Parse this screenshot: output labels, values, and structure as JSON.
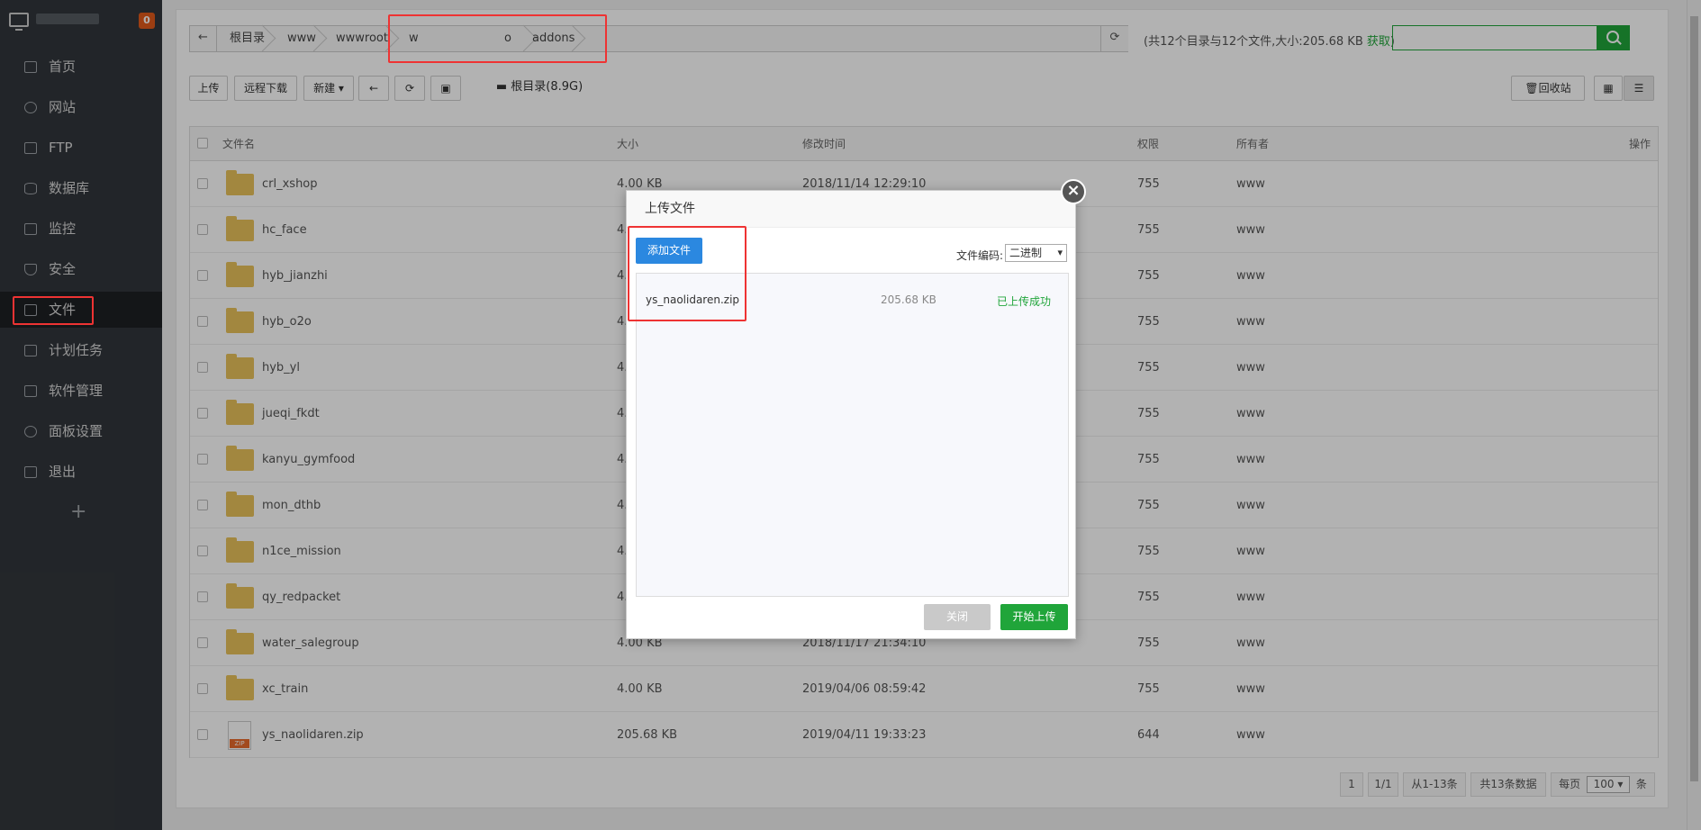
{
  "sidebar": {
    "badge": "0",
    "items": [
      {
        "label": "首页",
        "icon": "home-icon"
      },
      {
        "label": "网站",
        "icon": "globe-icon"
      },
      {
        "label": "FTP",
        "icon": "ftp-icon"
      },
      {
        "label": "数据库",
        "icon": "database-icon"
      },
      {
        "label": "监控",
        "icon": "monitor-icon"
      },
      {
        "label": "安全",
        "icon": "shield-icon"
      },
      {
        "label": "文件",
        "icon": "folder-icon"
      },
      {
        "label": "计划任务",
        "icon": "calendar-icon"
      },
      {
        "label": "软件管理",
        "icon": "apps-icon"
      },
      {
        "label": "面板设置",
        "icon": "gear-icon"
      },
      {
        "label": "退出",
        "icon": "logout-icon"
      }
    ],
    "add": "+"
  },
  "breadcrumb": [
    "根目录",
    "www",
    "wwwroot",
    "w",
    "o",
    "addons"
  ],
  "dir_info": {
    "text": "(共12个目录与12个文件,大小:205.68 KB",
    "link": "获取",
    "close": ")"
  },
  "toolbar": {
    "upload": "上传",
    "remote_download": "远程下载",
    "new": "新建",
    "root_disk": "根目录(8.9G)",
    "recycle": "回收站"
  },
  "table": {
    "headers": {
      "name": "文件名",
      "size": "大小",
      "mtime": "修改时间",
      "perm": "权限",
      "owner": "所有者",
      "ops": "操作"
    },
    "rows": [
      {
        "name": "crl_xshop",
        "size": "4.00 KB",
        "mtime": "2018/11/14 12:29:10",
        "perm": "755",
        "owner": "www",
        "type": "folder"
      },
      {
        "name": "hc_face",
        "size": "4.",
        "mtime": "",
        "perm": "755",
        "owner": "www",
        "type": "folder"
      },
      {
        "name": "hyb_jianzhi",
        "size": "4.",
        "mtime": "",
        "perm": "755",
        "owner": "www",
        "type": "folder"
      },
      {
        "name": "hyb_o2o",
        "size": "4.",
        "mtime": "",
        "perm": "755",
        "owner": "www",
        "type": "folder"
      },
      {
        "name": "hyb_yl",
        "size": "4.",
        "mtime": "",
        "perm": "755",
        "owner": "www",
        "type": "folder"
      },
      {
        "name": "jueqi_fkdt",
        "size": "4.",
        "mtime": "",
        "perm": "755",
        "owner": "www",
        "type": "folder"
      },
      {
        "name": "kanyu_gymfood",
        "size": "4.",
        "mtime": "",
        "perm": "755",
        "owner": "www",
        "type": "folder"
      },
      {
        "name": "mon_dthb",
        "size": "4.",
        "mtime": "",
        "perm": "755",
        "owner": "www",
        "type": "folder"
      },
      {
        "name": "n1ce_mission",
        "size": "4.",
        "mtime": "",
        "perm": "755",
        "owner": "www",
        "type": "folder"
      },
      {
        "name": "qy_redpacket",
        "size": "4.",
        "mtime": "",
        "perm": "755",
        "owner": "www",
        "type": "folder"
      },
      {
        "name": "water_salegroup",
        "size": "4.00 KB",
        "mtime": "2018/11/17 21:34:10",
        "perm": "755",
        "owner": "www",
        "type": "folder"
      },
      {
        "name": "xc_train",
        "size": "4.00 KB",
        "mtime": "2019/04/06 08:59:42",
        "perm": "755",
        "owner": "www",
        "type": "folder"
      },
      {
        "name": "ys_naolidaren.zip",
        "size": "205.68 KB",
        "mtime": "2019/04/11 19:33:23",
        "perm": "644",
        "owner": "www",
        "type": "zip"
      }
    ]
  },
  "pager": {
    "page": "1",
    "pages": "1/1",
    "range": "从1-13条",
    "total": "共13条数据",
    "per_page_label": "每页",
    "per_page": "100",
    "unit": "条"
  },
  "modal": {
    "title": "上传文件",
    "add_file": "添加文件",
    "encoding_label": "文件编码:",
    "encoding_value": "二进制",
    "file": {
      "name": "ys_naolidaren.zip",
      "size": "205.68 KB",
      "status": "已上传成功"
    },
    "close_btn": "关闭",
    "start_btn": "开始上传"
  },
  "colors": {
    "brand_green": "#20a53a",
    "sidebar_bg": "#32363b",
    "primary_blue": "#2b88e0",
    "highlight_red": "#e33333"
  }
}
